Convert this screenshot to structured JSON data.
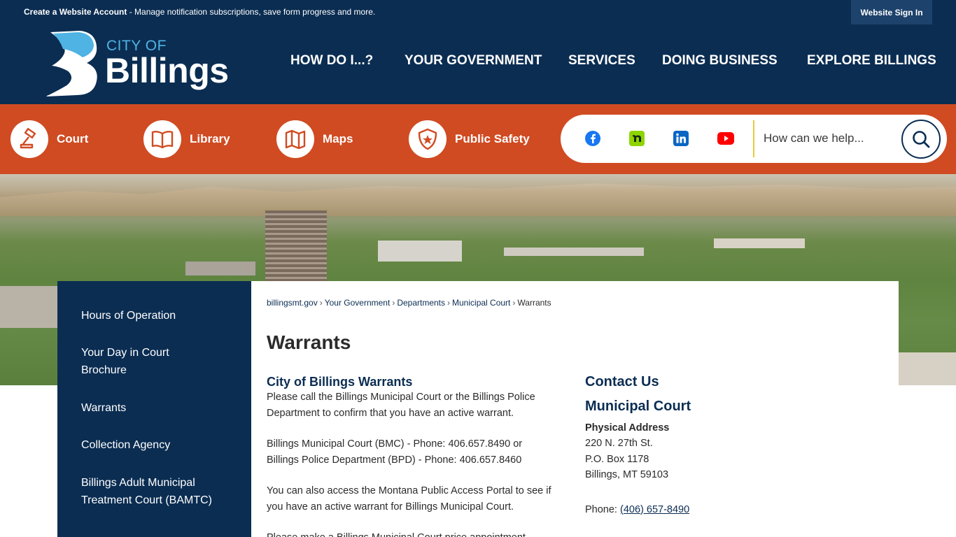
{
  "topbar": {
    "account_link": "Create a Website Account",
    "account_msg": " - Manage notification subscriptions, save form progress and more.",
    "signin": "Website Sign In"
  },
  "logo": {
    "city": "CITY OF",
    "name": "Billings"
  },
  "nav": {
    "items": [
      "HOW DO I...?",
      "YOUR GOVERNMENT",
      "SERVICES",
      "DOING BUSINESS",
      "EXPLORE BILLINGS"
    ]
  },
  "quicklinks": [
    {
      "label": "Court",
      "icon": "gavel-icon"
    },
    {
      "label": "Library",
      "icon": "book-icon"
    },
    {
      "label": "Maps",
      "icon": "map-icon"
    },
    {
      "label": "Public Safety",
      "icon": "badge-icon"
    }
  ],
  "social": [
    {
      "name": "facebook-icon",
      "color": "#1877f2"
    },
    {
      "name": "nextdoor-icon",
      "color": "#8ed500"
    },
    {
      "name": "linkedin-icon",
      "color": "#0a66c2"
    },
    {
      "name": "youtube-icon",
      "color": "#ff0000"
    }
  ],
  "search": {
    "placeholder": "How can we help..."
  },
  "sidenav": {
    "items": [
      "Hours of Operation",
      "Your Day in Court Brochure",
      "Warrants",
      "Collection Agency",
      "Billings Adult Municipal Treatment Court (BAMTC)"
    ]
  },
  "breadcrumb": {
    "items": [
      "billingsmt.gov",
      "Your Government",
      "Departments",
      "Municipal Court",
      "Warrants"
    ],
    "separator": "›"
  },
  "page": {
    "title": "Warrants",
    "section_title": "City of Billings Warrants",
    "para1": "Please call the Billings Municipal Court or the Billings Police Department to confirm that you have an active warrant.",
    "para2a": "Billings Municipal Court (BMC) -  Phone: 406.657.8490 or",
    "para2b": "Billings Police Department (BPD) - Phone: 406.657.8460",
    "para3": "You can also access the Montana Public Access Portal to see if you have an active warrant for Billings Municipal Court.",
    "para4_partial": "Please make a Billings Municipal Court price appointment"
  },
  "contact": {
    "heading": "Contact Us",
    "org": "Municipal Court",
    "address_label": "Physical Address",
    "address_lines": [
      "220 N. 27th St.",
      "P.O. Box 1178",
      "Billings, MT 59103"
    ],
    "phone_label": "Phone: ",
    "phone": "(406) 657-8490"
  },
  "colors": {
    "navy": "#0b2d52",
    "orange": "#d04b22",
    "accent_blue": "#4fb3e4"
  }
}
